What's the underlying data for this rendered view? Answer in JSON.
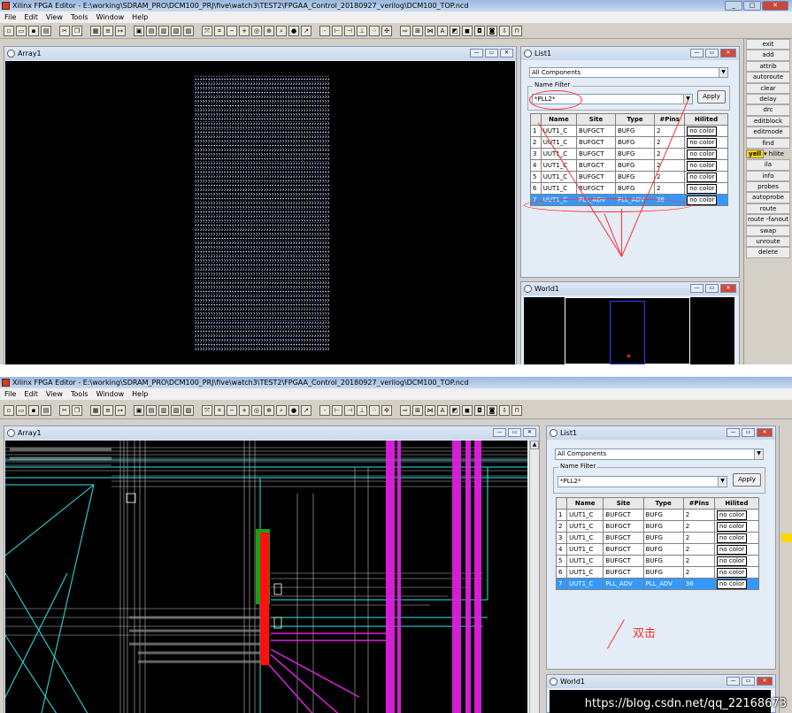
{
  "window": {
    "title": "Xilinx FPGA Editor - E:\\working\\SDRAM_PRO\\DCM100_PRJ\\five\\watch3\\TEST2\\FPGAA_Control_20180927_verilog\\DCM100_TOP.ncd"
  },
  "menu": [
    "File",
    "Edit",
    "View",
    "Tools",
    "Window",
    "Help"
  ],
  "panels": {
    "array": "Array1",
    "list": "List1",
    "world": "World1"
  },
  "list": {
    "filter_select": "All Components",
    "name_filter_label": "Name Filter",
    "name_filter_value": "*PLL2*",
    "apply_label": "Apply",
    "columns": [
      "",
      "Name",
      "Site",
      "Type",
      "#Pins",
      "Hilited"
    ],
    "rows": [
      [
        "1",
        "UUT1_C",
        "BUFGCT",
        "BUFG",
        "2",
        "no color"
      ],
      [
        "2",
        "UUT1_C",
        "BUFGCT",
        "BUFG",
        "2",
        "no color"
      ],
      [
        "3",
        "UUT1_C",
        "BUFGCT",
        "BUFG",
        "2",
        "no color"
      ],
      [
        "4",
        "UUT1_C",
        "BUFGCT",
        "BUFG",
        "2",
        "no color"
      ],
      [
        "5",
        "UUT1_C",
        "BUFGCT",
        "BUFG",
        "2",
        "no color"
      ],
      [
        "6",
        "UUT1_C",
        "BUFGCT",
        "BUFG",
        "2",
        "no color"
      ],
      [
        "7",
        "UUT1_C",
        "PLL_ADV",
        "PLL_ADV",
        "36",
        "no color"
      ]
    ]
  },
  "commands": [
    "exit",
    "add",
    "attrib",
    "autoroute",
    "clear",
    "delay",
    "drc",
    "editblock",
    "editmode",
    "find",
    "ila",
    "info",
    "probes",
    "autoprobe",
    "route",
    "route -fanout",
    "swap",
    "unroute",
    "delete"
  ],
  "hilite": {
    "color": "yell",
    "label": "hilite"
  },
  "annotation": "双击",
  "watermark": "https://blog.csdn.net/qq_22168673",
  "colors": {
    "selected_row": "#3399ff",
    "annotation": "#ff3030",
    "route_cyan": "#2ee8e8",
    "route_magenta": "#e020e0",
    "block_red": "#ff1010"
  }
}
